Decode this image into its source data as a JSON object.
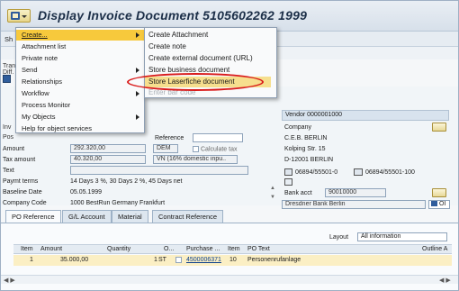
{
  "window": {
    "title": "Display Invoice Document 5105602262 1999"
  },
  "menubar": {
    "first_tab_partial": "Sh"
  },
  "side_labels": {
    "trans": "Trans",
    "diff": "Diff.",
    "inv": "Inv",
    "pos": "Pos"
  },
  "partial_doc_year": "999",
  "context_menu": {
    "items": [
      {
        "label": "Create...",
        "submenu": true,
        "highlighted": true
      },
      {
        "label": "Attachment list",
        "submenu": false
      },
      {
        "label": "Private note",
        "submenu": false
      },
      {
        "label": "Send",
        "submenu": true
      },
      {
        "label": "Relationships",
        "submenu": false
      },
      {
        "label": "Workflow",
        "submenu": true
      },
      {
        "label": "Process Monitor",
        "submenu": false
      },
      {
        "label": "My Objects",
        "submenu": true
      },
      {
        "label": "Help for object services",
        "submenu": false
      }
    ]
  },
  "submenu": {
    "items": [
      {
        "label": "Create Attachment"
      },
      {
        "label": "Create note"
      },
      {
        "label": "Create external document (URL)"
      },
      {
        "label": "Store business document"
      },
      {
        "label": "Store Laserfiche document",
        "highlighted": true
      },
      {
        "label": "Enter bar code",
        "disabled": true
      }
    ]
  },
  "form": {
    "reference_label": "Reference",
    "amount_label": "Amount",
    "amount_value": "292.320,00",
    "currency": "DEM",
    "calc_tax_label": "Calculate tax",
    "tax_amount_label": "Tax amount",
    "tax_amount_value": "40.320,00",
    "tax_code": "VN (16% domestic inpu..",
    "text_label": "Text",
    "paymt_terms_label": "Paymt terms",
    "paymt_terms_value": "14 Days 3 %, 30 Days 2 %, 45 Days net",
    "baseline_date_label": "Baseline Date",
    "baseline_date_value": "05.05.1999",
    "company_code_label": "Company Code",
    "company_code_value": "1000 BestRun Germany Frankfurt"
  },
  "vendor": {
    "header": "Vendor 0000001000",
    "lines": [
      "Company",
      "C.E.B. BERLIN",
      "Kolping Str. 15",
      "D-12001 BERLIN"
    ],
    "phone": "06894/55501-0",
    "fax": "06894/55501-100",
    "bank_acct_label": "Bank acct",
    "bank_acct_value": "90010000",
    "bank_name": "Dresdner Bank Berlin",
    "oi_label": "OI"
  },
  "tabs": [
    {
      "label": "PO Reference",
      "active": true
    },
    {
      "label": "G/L Account"
    },
    {
      "label": "Material"
    },
    {
      "label": "Contract Reference"
    }
  ],
  "grid": {
    "layout_label": "Layout",
    "layout_value": "All information",
    "headers": [
      "Item",
      "Amount",
      "Quantity",
      "O...",
      "Purchase ...",
      "Item",
      "PO Text",
      "Outline A"
    ],
    "row": {
      "item": "1",
      "amount": "35.000,00",
      "quantity": "1",
      "unit": "ST",
      "purchase_order": "4500006371",
      "po_item": "10",
      "po_text": "Personenrufanlage"
    }
  },
  "colors": {
    "highlight": "#f7c93c",
    "annotation": "#d91a1a",
    "title_text": "#1c2f48"
  }
}
